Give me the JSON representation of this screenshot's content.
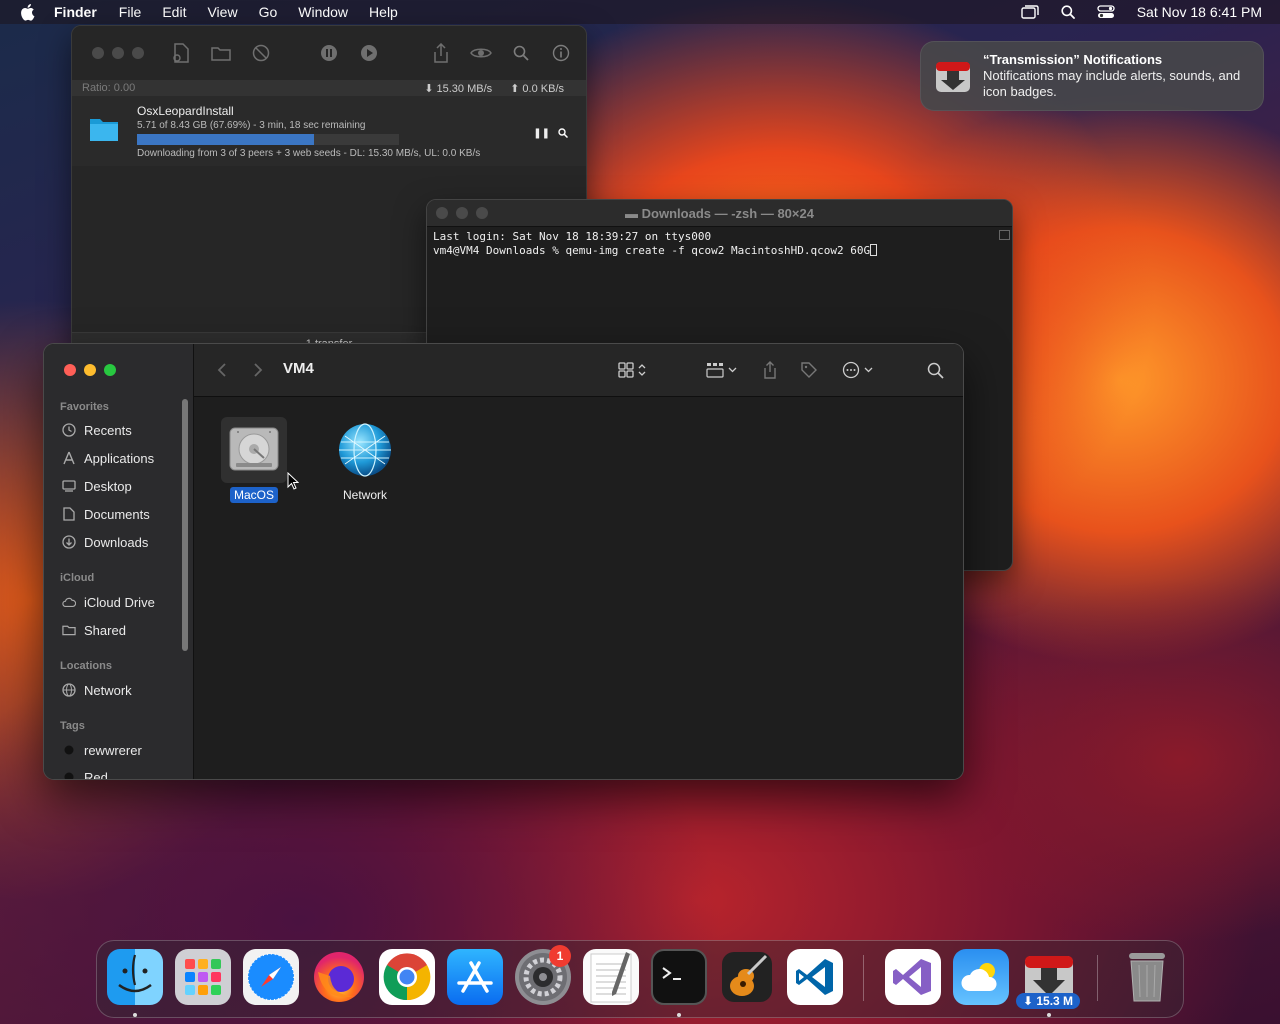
{
  "menubar": {
    "app_name": "Finder",
    "items": [
      "File",
      "Edit",
      "View",
      "Go",
      "Window",
      "Help"
    ],
    "clock": "Sat Nov 18  6:41 PM"
  },
  "notification": {
    "title": "“Transmission” Notifications",
    "body": "Notifications may include alerts, sounds, and icon badges."
  },
  "transmission": {
    "ratio": "Ratio: 0.00",
    "download_rate": "15.30 MB/s",
    "upload_rate": "0.0 KB/s",
    "torrent": {
      "name": "OsxLeopardInstall",
      "progress_text": "5.71 of 8.43 GB (67.69%) - 3 min, 18 sec remaining",
      "progress_percent": 67.69,
      "status": "Downloading from 3 of 3 peers + 3 web seeds - DL: 15.30 MB/s, UL: 0.0 KB/s"
    },
    "footer": "1 transfer"
  },
  "terminal": {
    "title": "Downloads — -zsh — 80×24",
    "line1": "Last login: Sat Nov 18 18:39:27 on ttys000",
    "line2": "vm4@VM4 Downloads % qemu-img create -f qcow2 MacintoshHD.qcow2 60G"
  },
  "finder": {
    "title": "VM4",
    "sidebar": {
      "favorites_header": "Favorites",
      "favorites": [
        "Recents",
        "Applications",
        "Desktop",
        "Documents",
        "Downloads"
      ],
      "icloud_header": "iCloud",
      "icloud": [
        "iCloud Drive",
        "Shared"
      ],
      "locations_header": "Locations",
      "locations": [
        "Network"
      ],
      "tags_header": "Tags",
      "tags": [
        "rewwrerer",
        "Red"
      ]
    },
    "items": [
      {
        "name": "MacOS",
        "icon": "hard-drive-icon",
        "selected": true
      },
      {
        "name": "Network",
        "icon": "network-globe-icon",
        "selected": false
      }
    ]
  },
  "dock": {
    "apps": [
      "Finder",
      "Launchpad",
      "Safari",
      "Firefox",
      "Chrome",
      "App Store",
      "System Settings",
      "TextEdit",
      "Terminal",
      "GarageBand",
      "Visual Studio Code",
      "Visual Studio",
      "Weather",
      "Transmission",
      "Trash"
    ],
    "settings_badge": "1",
    "transmission_badge": "⬇ 15.3 M"
  },
  "colors": {
    "accent": "#1d62c9",
    "close": "#ff5f57",
    "minimize": "#febc2e",
    "zoom": "#28c840"
  }
}
